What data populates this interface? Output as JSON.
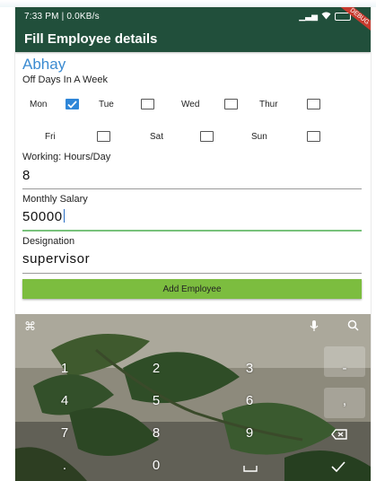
{
  "status": {
    "time": "7:33 PM | 0.0KB/s",
    "debug_badge": "DEBUG"
  },
  "appbar": {
    "title": "Fill Employee details"
  },
  "form": {
    "employee_name": "Abhay",
    "off_days_label": "Off Days In A Week",
    "days": [
      {
        "label": "Mon",
        "checked": true
      },
      {
        "label": "Tue",
        "checked": false
      },
      {
        "label": "Wed",
        "checked": false
      },
      {
        "label": "Thur",
        "checked": false
      },
      {
        "label": "Fri",
        "checked": false
      },
      {
        "label": "Sat",
        "checked": false
      },
      {
        "label": "Sun",
        "checked": false
      }
    ],
    "hours": {
      "label": "Working: Hours/Day",
      "value": "8"
    },
    "salary": {
      "label": "Monthly Salary",
      "value": "50000"
    },
    "designation": {
      "label": "Designation",
      "value": "supervisor"
    },
    "add_button": "Add Employee"
  },
  "keyboard": {
    "keys": [
      [
        "1",
        "2",
        "3",
        "-"
      ],
      [
        "4",
        "5",
        "6",
        ","
      ],
      [
        "7",
        "8",
        "9",
        ""
      ],
      [
        ".",
        "0",
        "",
        ""
      ]
    ],
    "accent_color": "#214f3b",
    "button_color": "#7cbd3f",
    "name_color": "#3b8bd1"
  }
}
